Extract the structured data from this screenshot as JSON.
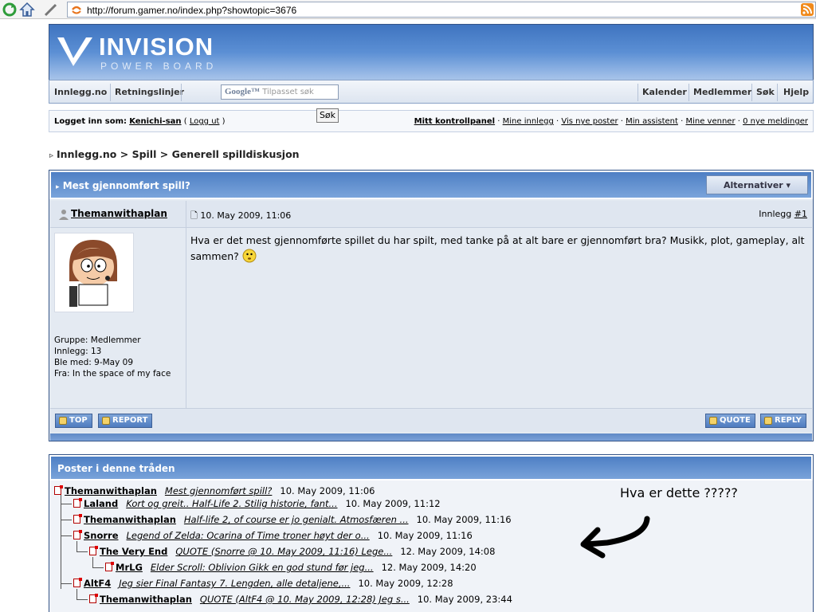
{
  "browser": {
    "url": "http://forum.gamer.no/index.php?showtopic=3676"
  },
  "logo": {
    "title": "INVISION",
    "subtitle": "POWER BOARD"
  },
  "nav": {
    "left": [
      "Innlegg.no",
      "Retningslinjer"
    ],
    "search_placeholder": "Tilpasset søk",
    "search_brand": "Google™",
    "search_button": "Søk",
    "right": [
      "Kalender",
      "Medlemmer",
      "Søk",
      "Hjelp"
    ]
  },
  "userbar": {
    "logged_in_label": "Logget inn som:",
    "username": "Kenichi-san",
    "logout": "Logg ut",
    "links": [
      "Mitt kontrollpanel",
      "Mine innlegg",
      "Vis nye poster",
      "Min assistent",
      "Mine venner",
      "0 nye meldinger"
    ]
  },
  "breadcrumb": [
    "Innlegg.no",
    "Spill",
    "Generell spilldiskusjon"
  ],
  "topic": {
    "title": "Mest gjennomført spill?",
    "options_button": "Alternativer ▾",
    "post": {
      "author": "Themanwithaplan",
      "date": "10. May 2009, 11:06",
      "post_label": "Innlegg",
      "post_number": "#1",
      "body": "Hva er det mest gjennomførte spillet du har spilt, med tanke på at alt bare er gjennomført bra? Musikk, plot, gameplay, alt sammen?",
      "meta": [
        "Gruppe: Medlemmer",
        "Innlegg: 13",
        "Ble med: 9-May 09",
        "Fra: In the space of my face"
      ],
      "buttons": {
        "top": "TOP",
        "report": "REPORT",
        "quote": "QUOTE",
        "reply": "REPLY"
      }
    }
  },
  "thread": {
    "title": "Poster i denne tråden",
    "rows": [
      {
        "name": "Themanwithaplan",
        "snippet": "Mest gjennomført spill?",
        "date": "10. May 2009, 11:06"
      },
      {
        "name": "Laland",
        "snippet": "Kort og greit.. Half-Life 2. Stilig historie, fant...",
        "date": "10. May 2009, 11:12"
      },
      {
        "name": "Themanwithaplan",
        "snippet": "Half-life 2, of course er jo genialt. Atmosfæren ...",
        "date": "10. May 2009, 11:16"
      },
      {
        "name": "Snorre",
        "snippet": "Legend of Zelda: Ocarina of Time troner høyt der o...",
        "date": "10. May 2009, 11:16"
      },
      {
        "name": "The Very End",
        "snippet": "QUOTE (Snorre @ 10. May 2009, 11:16) Lege...",
        "date": "12. May 2009, 14:08"
      },
      {
        "name": "MrLG",
        "snippet": "Elder Scroll: Oblivion Gikk en god stund før jeg...",
        "date": "12. May 2009, 14:20"
      },
      {
        "name": "AltF4",
        "snippet": "Jeg sier Final Fantasy 7. Lengden, alle detaljene,...",
        "date": "10. May 2009, 12:28"
      },
      {
        "name": "Themanwithaplan",
        "snippet": "QUOTE (AltF4 @ 10. May 2009, 12:28) Jeg s...",
        "date": "10. May 2009, 23:44"
      }
    ]
  },
  "annotation": {
    "text": "Hva er dette ?????"
  },
  "colors": {
    "header_blue": "#4e7fc4",
    "border_blue": "#345487",
    "panel_bg": "#e4eaf2"
  }
}
